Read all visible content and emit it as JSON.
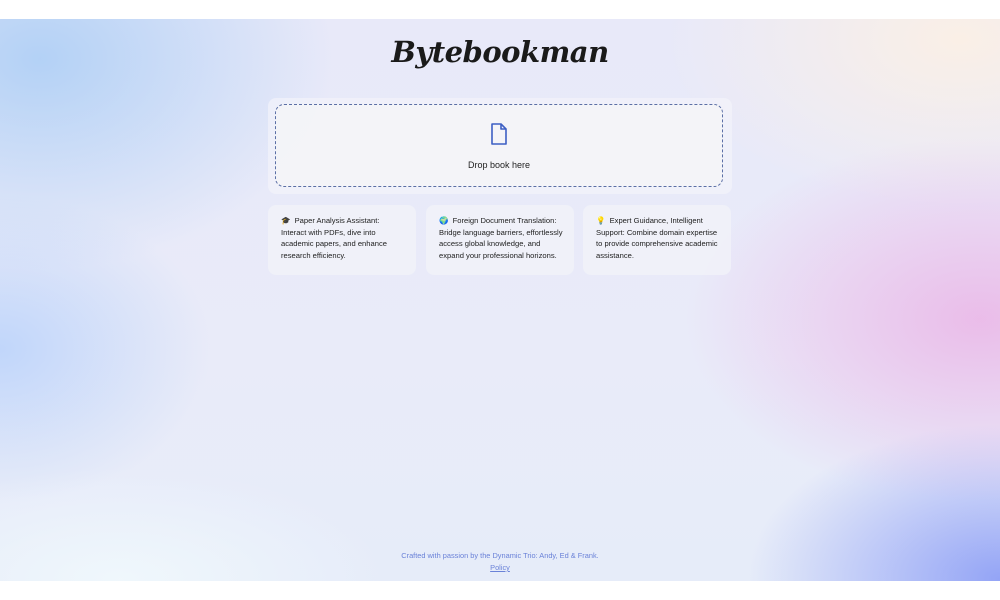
{
  "app": {
    "logo": "Bytebookman"
  },
  "upload": {
    "icon": "file-icon",
    "label": "Drop book here"
  },
  "features": [
    {
      "icon": "graduation-cap",
      "emoji": "🎓",
      "text": "Paper Analysis Assistant: Interact with PDFs, dive into academic papers, and enhance research efficiency."
    },
    {
      "icon": "globe",
      "emoji": "🌍",
      "text": "Foreign Document Translation: Bridge language barriers, effortlessly access global knowledge, and expand your professional horizons."
    },
    {
      "icon": "lightbulb",
      "emoji": "💡",
      "text": "Expert Guidance, Intelligent Support: Combine domain expertise to provide comprehensive academic assistance."
    }
  ],
  "footer": {
    "credit": "Crafted with passion by the Dynamic Trio: Andy, Ed & Frank.",
    "policy_link": "Policy"
  },
  "colors": {
    "accent": "#6a82d8",
    "dashed_border": "#5b6fa6",
    "text": "#222222"
  }
}
